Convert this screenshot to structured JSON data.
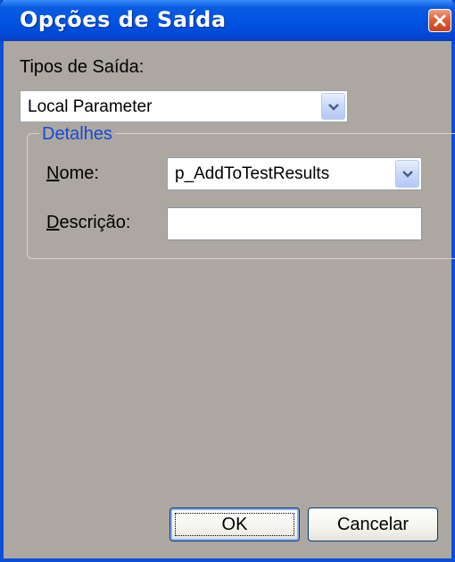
{
  "window": {
    "title": "Opções de Saída",
    "close_icon": "close-icon"
  },
  "output_types": {
    "label": "Tipos de Saída:",
    "selected": "Local Parameter"
  },
  "details": {
    "legend": "Detalhes",
    "name_label_accel": "N",
    "name_label_rest": "ome:",
    "name_value": "p_AddToTestResults",
    "description_label_accel": "D",
    "description_label_rest": "escrição:",
    "description_value": ""
  },
  "buttons": {
    "ok": "OK",
    "cancel": "Cancelar"
  },
  "colors": {
    "titlebar": "#0054e3",
    "dialog_bg": "#ACA8A1",
    "legend_text": "#1a48d4",
    "close_button": "#e0603a"
  }
}
